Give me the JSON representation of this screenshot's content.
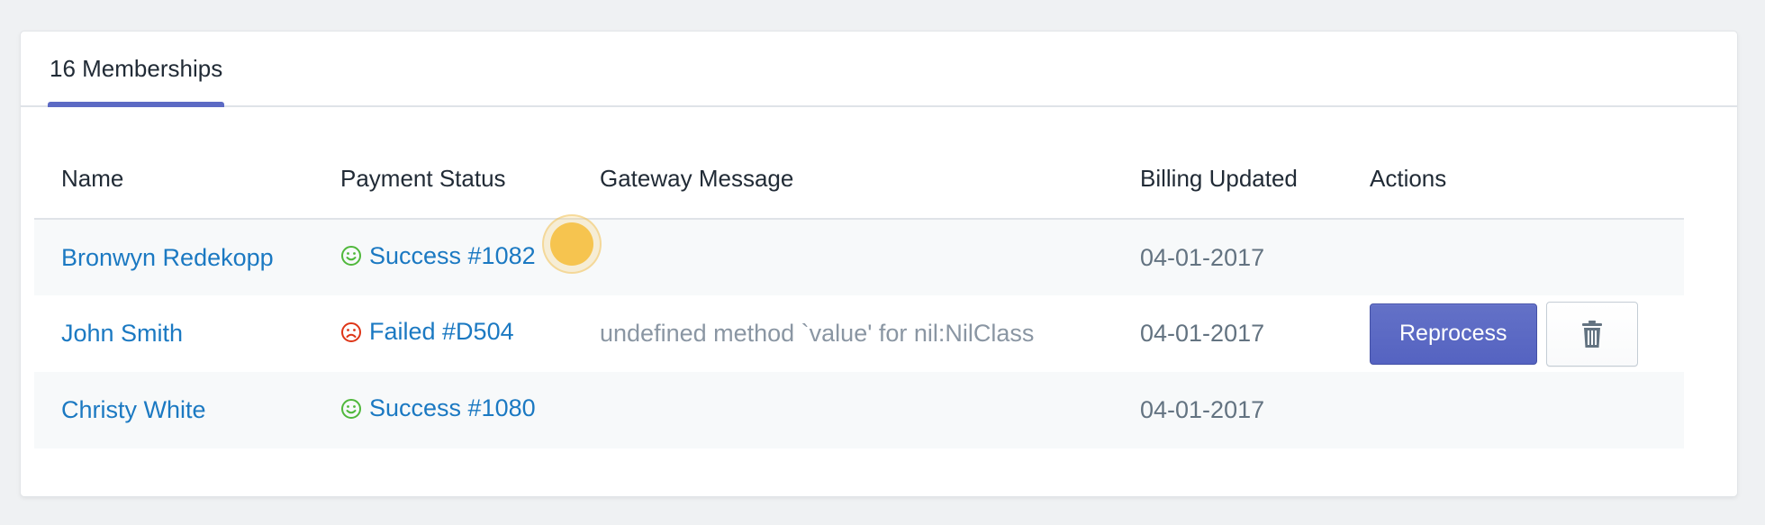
{
  "tabs": {
    "memberships_label": "16 Memberships"
  },
  "table": {
    "headers": [
      "Name",
      "Payment Status",
      "Gateway Message",
      "Billing Updated",
      "Actions"
    ],
    "rows": [
      {
        "name": "Bronwyn Redekopp",
        "status": "Success #1082",
        "status_kind": "success",
        "gateway_message": "",
        "billing_updated": "04-01-2017"
      },
      {
        "name": "John Smith",
        "status": "Failed #D504",
        "status_kind": "failed",
        "gateway_message": "undefined method `value' for nil:NilClass",
        "billing_updated": "04-01-2017",
        "reprocess_label": "Reprocess"
      },
      {
        "name": "Christy White",
        "status": "Success #1080",
        "status_kind": "success",
        "gateway_message": "",
        "billing_updated": "04-01-2017"
      }
    ]
  },
  "icons": {
    "success": "smile-icon",
    "failed": "frown-icon",
    "delete": "trash-icon"
  },
  "colors": {
    "accent": "#5c6ac4",
    "link": "#1b79c2",
    "success": "#50b83c",
    "failed": "#de3618",
    "cursor": "#f6c44f"
  }
}
